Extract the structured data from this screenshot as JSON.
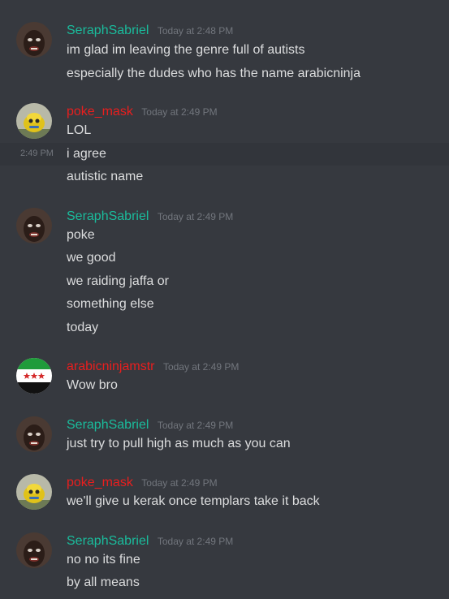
{
  "colors": {
    "background": "#36393f",
    "hover_row": "#32353b",
    "seraph": "#1abc9c",
    "poke": "#e91e1e",
    "arabic": "#e91e1e",
    "text": "#dcddde",
    "timestamp": "#72767d"
  },
  "messages": [
    {
      "author": "SeraphSabriel",
      "avatar_icon": "dark-face-avatar",
      "timestamp": "Today at 2:48 PM",
      "lines": [
        "im glad im leaving the genre full of autists",
        "especially the dudes who has the name arabicninja"
      ]
    },
    {
      "author": "poke_mask",
      "avatar_icon": "yellow-mask-avatar",
      "timestamp": "Today at 2:49 PM",
      "lines": [
        "LOL",
        "i agree",
        "autistic name"
      ],
      "hover_timestamp": "2:49 PM"
    },
    {
      "author": "SeraphSabriel",
      "avatar_icon": "dark-face-avatar",
      "timestamp": "Today at 2:49 PM",
      "lines": [
        "poke",
        "we good",
        "we raiding jaffa or",
        "something else",
        "today"
      ]
    },
    {
      "author": "arabicninjamstr",
      "avatar_icon": "syrian-flag-avatar",
      "timestamp": "Today at 2:49 PM",
      "lines": [
        "Wow bro"
      ]
    },
    {
      "author": "SeraphSabriel",
      "avatar_icon": "dark-face-avatar",
      "timestamp": "Today at 2:49 PM",
      "lines": [
        "just try to pull high as much as you can"
      ]
    },
    {
      "author": "poke_mask",
      "avatar_icon": "yellow-mask-avatar",
      "timestamp": "Today at 2:49 PM",
      "lines": [
        "we'll give u kerak once templars take it back"
      ]
    },
    {
      "author": "SeraphSabriel",
      "avatar_icon": "dark-face-avatar",
      "timestamp": "Today at 2:49 PM",
      "lines": [
        "no no its fine",
        "by all means"
      ]
    }
  ]
}
